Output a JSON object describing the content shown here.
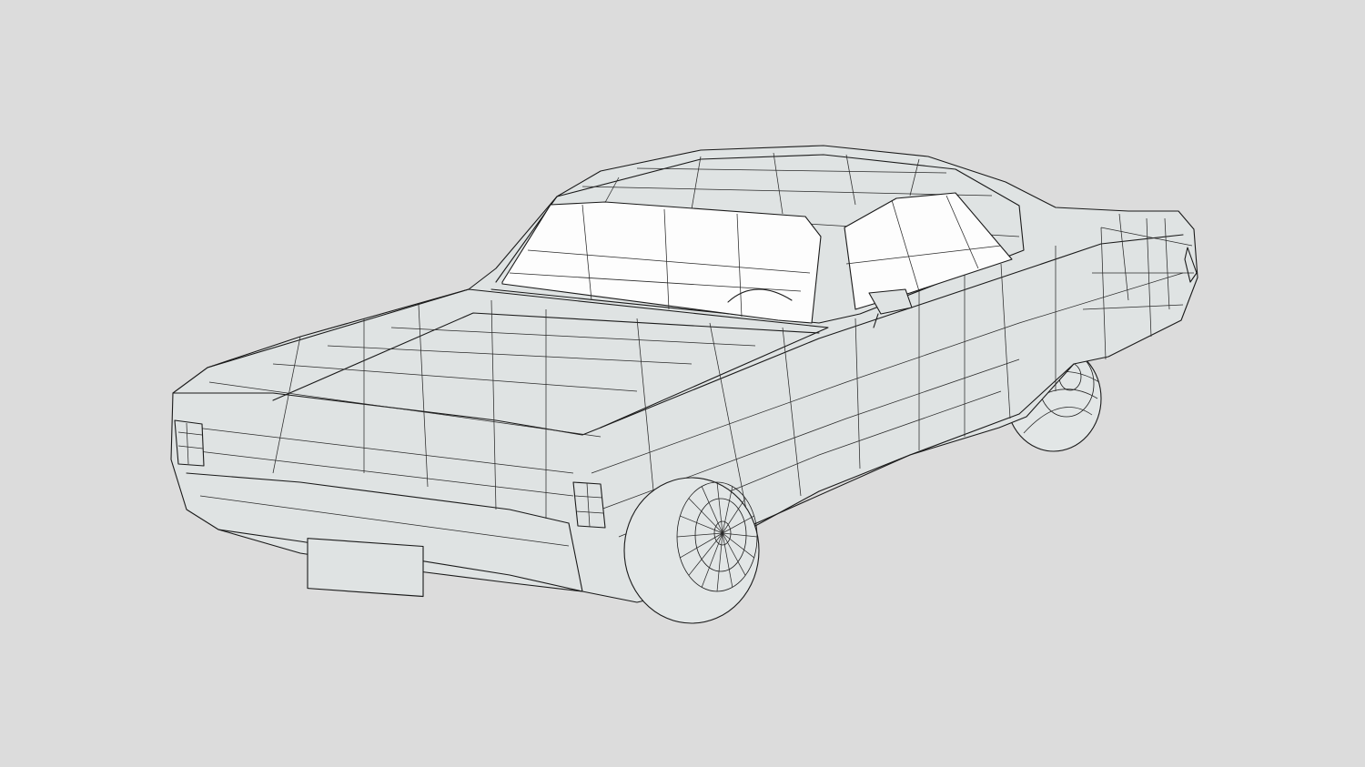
{
  "scene": {
    "subject": "car-wireframe",
    "background_color": "#dcdcdc",
    "body_color": "#dfe3e3",
    "glass_color": "#fdfdfd",
    "line_color": "#1a1a1a"
  }
}
